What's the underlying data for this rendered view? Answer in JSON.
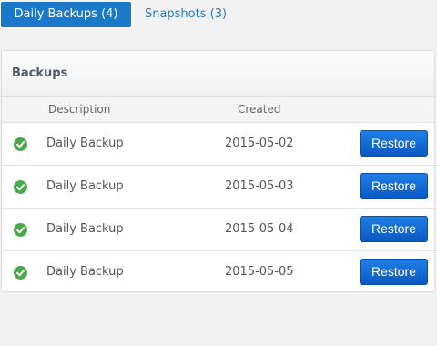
{
  "tabs": [
    {
      "label": "Daily Backups (4)",
      "active": true
    },
    {
      "label": "Snapshots (3)",
      "active": false
    }
  ],
  "panel": {
    "title": "Backups",
    "columns": {
      "description": "Description",
      "created": "Created"
    },
    "rows": [
      {
        "status_icon": "check-circle-icon",
        "description": "Daily Backup",
        "created": "2015-05-02",
        "action": "Restore"
      },
      {
        "status_icon": "check-circle-icon",
        "description": "Daily Backup",
        "created": "2015-05-03",
        "action": "Restore"
      },
      {
        "status_icon": "check-circle-icon",
        "description": "Daily Backup",
        "created": "2015-05-04",
        "action": "Restore"
      },
      {
        "status_icon": "check-circle-icon",
        "description": "Daily Backup",
        "created": "2015-05-05",
        "action": "Restore"
      }
    ]
  },
  "colors": {
    "accent": "#1c79c9",
    "link": "#2a7bbf",
    "status_ok": "#4aa84a",
    "button": "#0c58c2"
  }
}
